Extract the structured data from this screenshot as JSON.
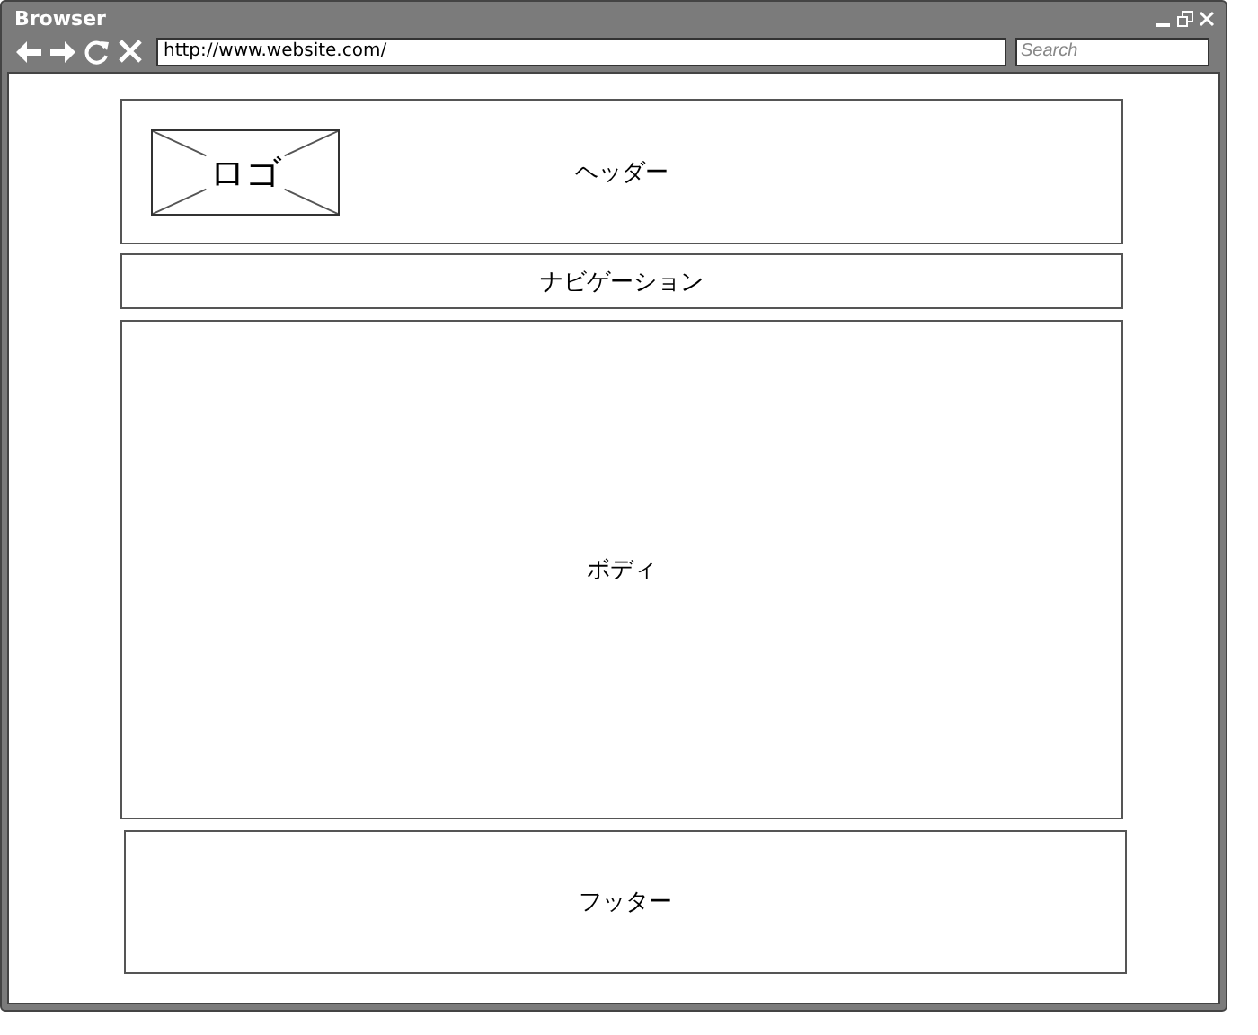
{
  "window": {
    "title": "Browser"
  },
  "toolbar": {
    "url": "http://www.website.com/",
    "search": {
      "placeholder": "Search"
    }
  },
  "page": {
    "header": {
      "logo": "ロゴ",
      "label": "ヘッダー"
    },
    "navigation": "ナビゲーション",
    "body": "ボディ",
    "footer": "フッター"
  }
}
